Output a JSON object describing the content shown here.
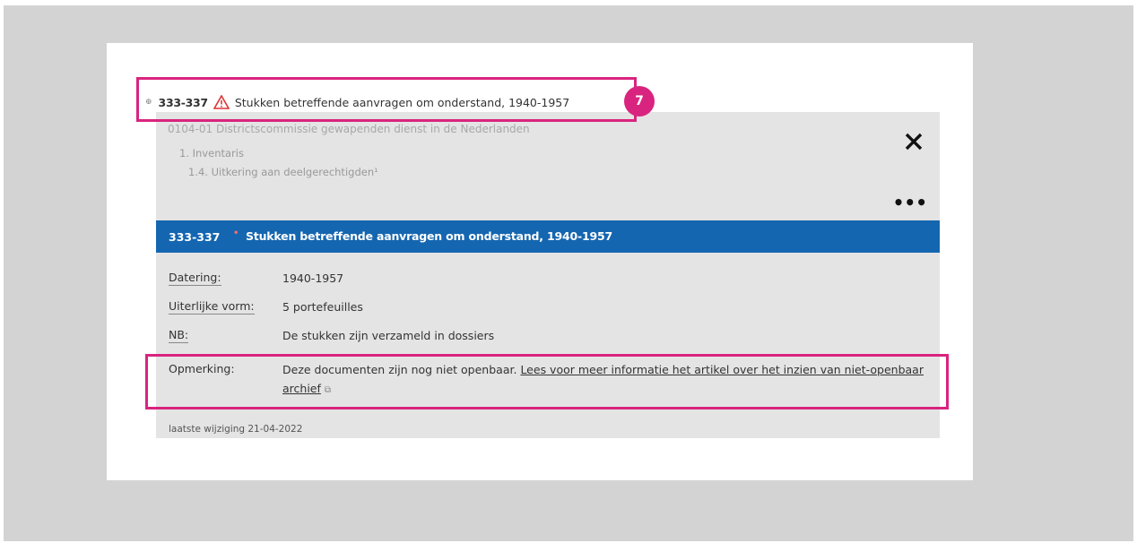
{
  "header": {
    "code": "333-337",
    "title": "Stukken betreffende aanvragen om onderstand, 1940-1957",
    "badge_number": "7"
  },
  "panel": {
    "archive_line": "0104-01 Districtscommissie gewapenden dienst in de Nederlanden",
    "breadcrumbs": [
      "1. Inventaris",
      "1.4. Uitkering aan deelgerechtigden¹"
    ],
    "bar_code": "333-337",
    "bar_title": "Stukken betreffende aanvragen om onderstand, 1940-1957",
    "fields": [
      {
        "label": "Datering:",
        "value": "1940-1957"
      },
      {
        "label": "Uiterlijke vorm:",
        "value": "5 portefeuilles"
      },
      {
        "label": "NB:",
        "value": "De stukken zijn verzameld in dossiers"
      },
      {
        "label": "Opmerking:",
        "value": "Deze documenten zijn nog niet openbaar. ",
        "link_text": "Lees voor meer informatie het artikel over het inzien van niet-openbaar archief"
      }
    ],
    "footer": "laatste wijziging 21-04-2022"
  },
  "colors": {
    "highlight": "#d9247f",
    "bar": "#1566b0",
    "panel_bg": "#e4e4e4",
    "frame_bg": "#d3d3d3"
  },
  "icons": [
    "expand-icon",
    "warning-icon",
    "close-icon",
    "more-icon",
    "external-link-icon"
  ]
}
